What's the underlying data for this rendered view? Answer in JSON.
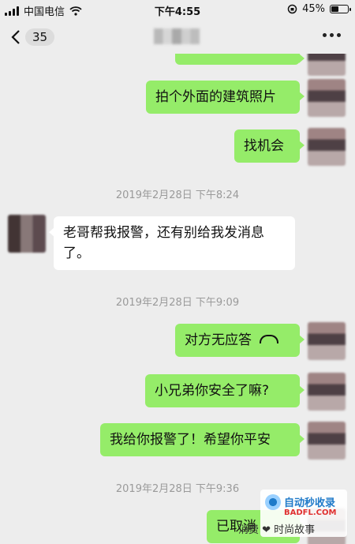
{
  "status_bar": {
    "carrier": "中国电信",
    "time": "下午4:55",
    "battery": "45%",
    "battery_level": 0.45
  },
  "nav": {
    "back_count": "35",
    "title": "",
    "more_label": "more"
  },
  "messages": [
    {
      "dir": "out",
      "text": ""
    },
    {
      "dir": "out",
      "text": "拍个外面的建筑照片"
    },
    {
      "dir": "out",
      "text": "找机会"
    },
    {
      "type": "timestamp",
      "text": "2019年2月28日 下午8:24"
    },
    {
      "dir": "in",
      "text": "老哥帮我报警，还有别给我发消息了。"
    },
    {
      "type": "timestamp",
      "text": "2019年2月28日 下午9:09"
    },
    {
      "dir": "out",
      "text": "对方无应答",
      "icon": "phone-hangup-icon"
    },
    {
      "dir": "out",
      "text": "小兄弟你安全了嘛?"
    },
    {
      "dir": "out",
      "text": "我给你报警了！希望你平安"
    },
    {
      "type": "timestamp",
      "text": "2019年2月28日 下午9:36"
    },
    {
      "dir": "out",
      "text": "已取消"
    }
  ],
  "watermark": {
    "line1": "自动秒收录",
    "line2": "BADFL.COM",
    "line3": "消费 ❤ 时尚故事"
  }
}
